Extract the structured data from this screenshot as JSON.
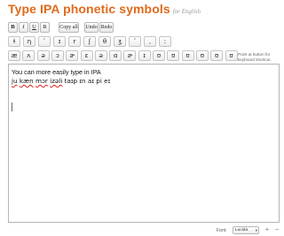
{
  "header": {
    "title": "Type IPA phonetic symbols",
    "subtitle": "for English"
  },
  "toolbar": {
    "bold_label": "B",
    "italic_label": "I",
    "underline_label": "U",
    "remove_format_label": "R",
    "copy_all_label": "Copy all",
    "undo_label": "Undo",
    "redo_label": "Redo"
  },
  "symbols_row1": [
    "ɫ",
    "η",
    "ʹ",
    "ɪ",
    "r",
    "ʃ",
    "θ",
    "ʒ",
    "ʹ",
    "ˌ",
    "ː"
  ],
  "symbols_row2": [
    "æ",
    "ʌ",
    "ə",
    "ɔ",
    "ɚ",
    "ɛ",
    "ə",
    "ɑ",
    "ɚ",
    "ɪ",
    "ʊ",
    "ʊ",
    "ʊ",
    "ʊ",
    "ʊ",
    "ʊ"
  ],
  "hint": "Point at button for keyboard shortcut.",
  "editor": {
    "line1": "You can more easily type in IPA",
    "line2_words": [
      "ju",
      "kæn",
      "mɔr",
      "izəli",
      "taɪp",
      "ɪn",
      "aɪ",
      "pi",
      "eɪ"
    ]
  },
  "font_controls": {
    "label": "Font:",
    "selected": "Lucida",
    "plus_label": "+",
    "minus_label": "−"
  }
}
